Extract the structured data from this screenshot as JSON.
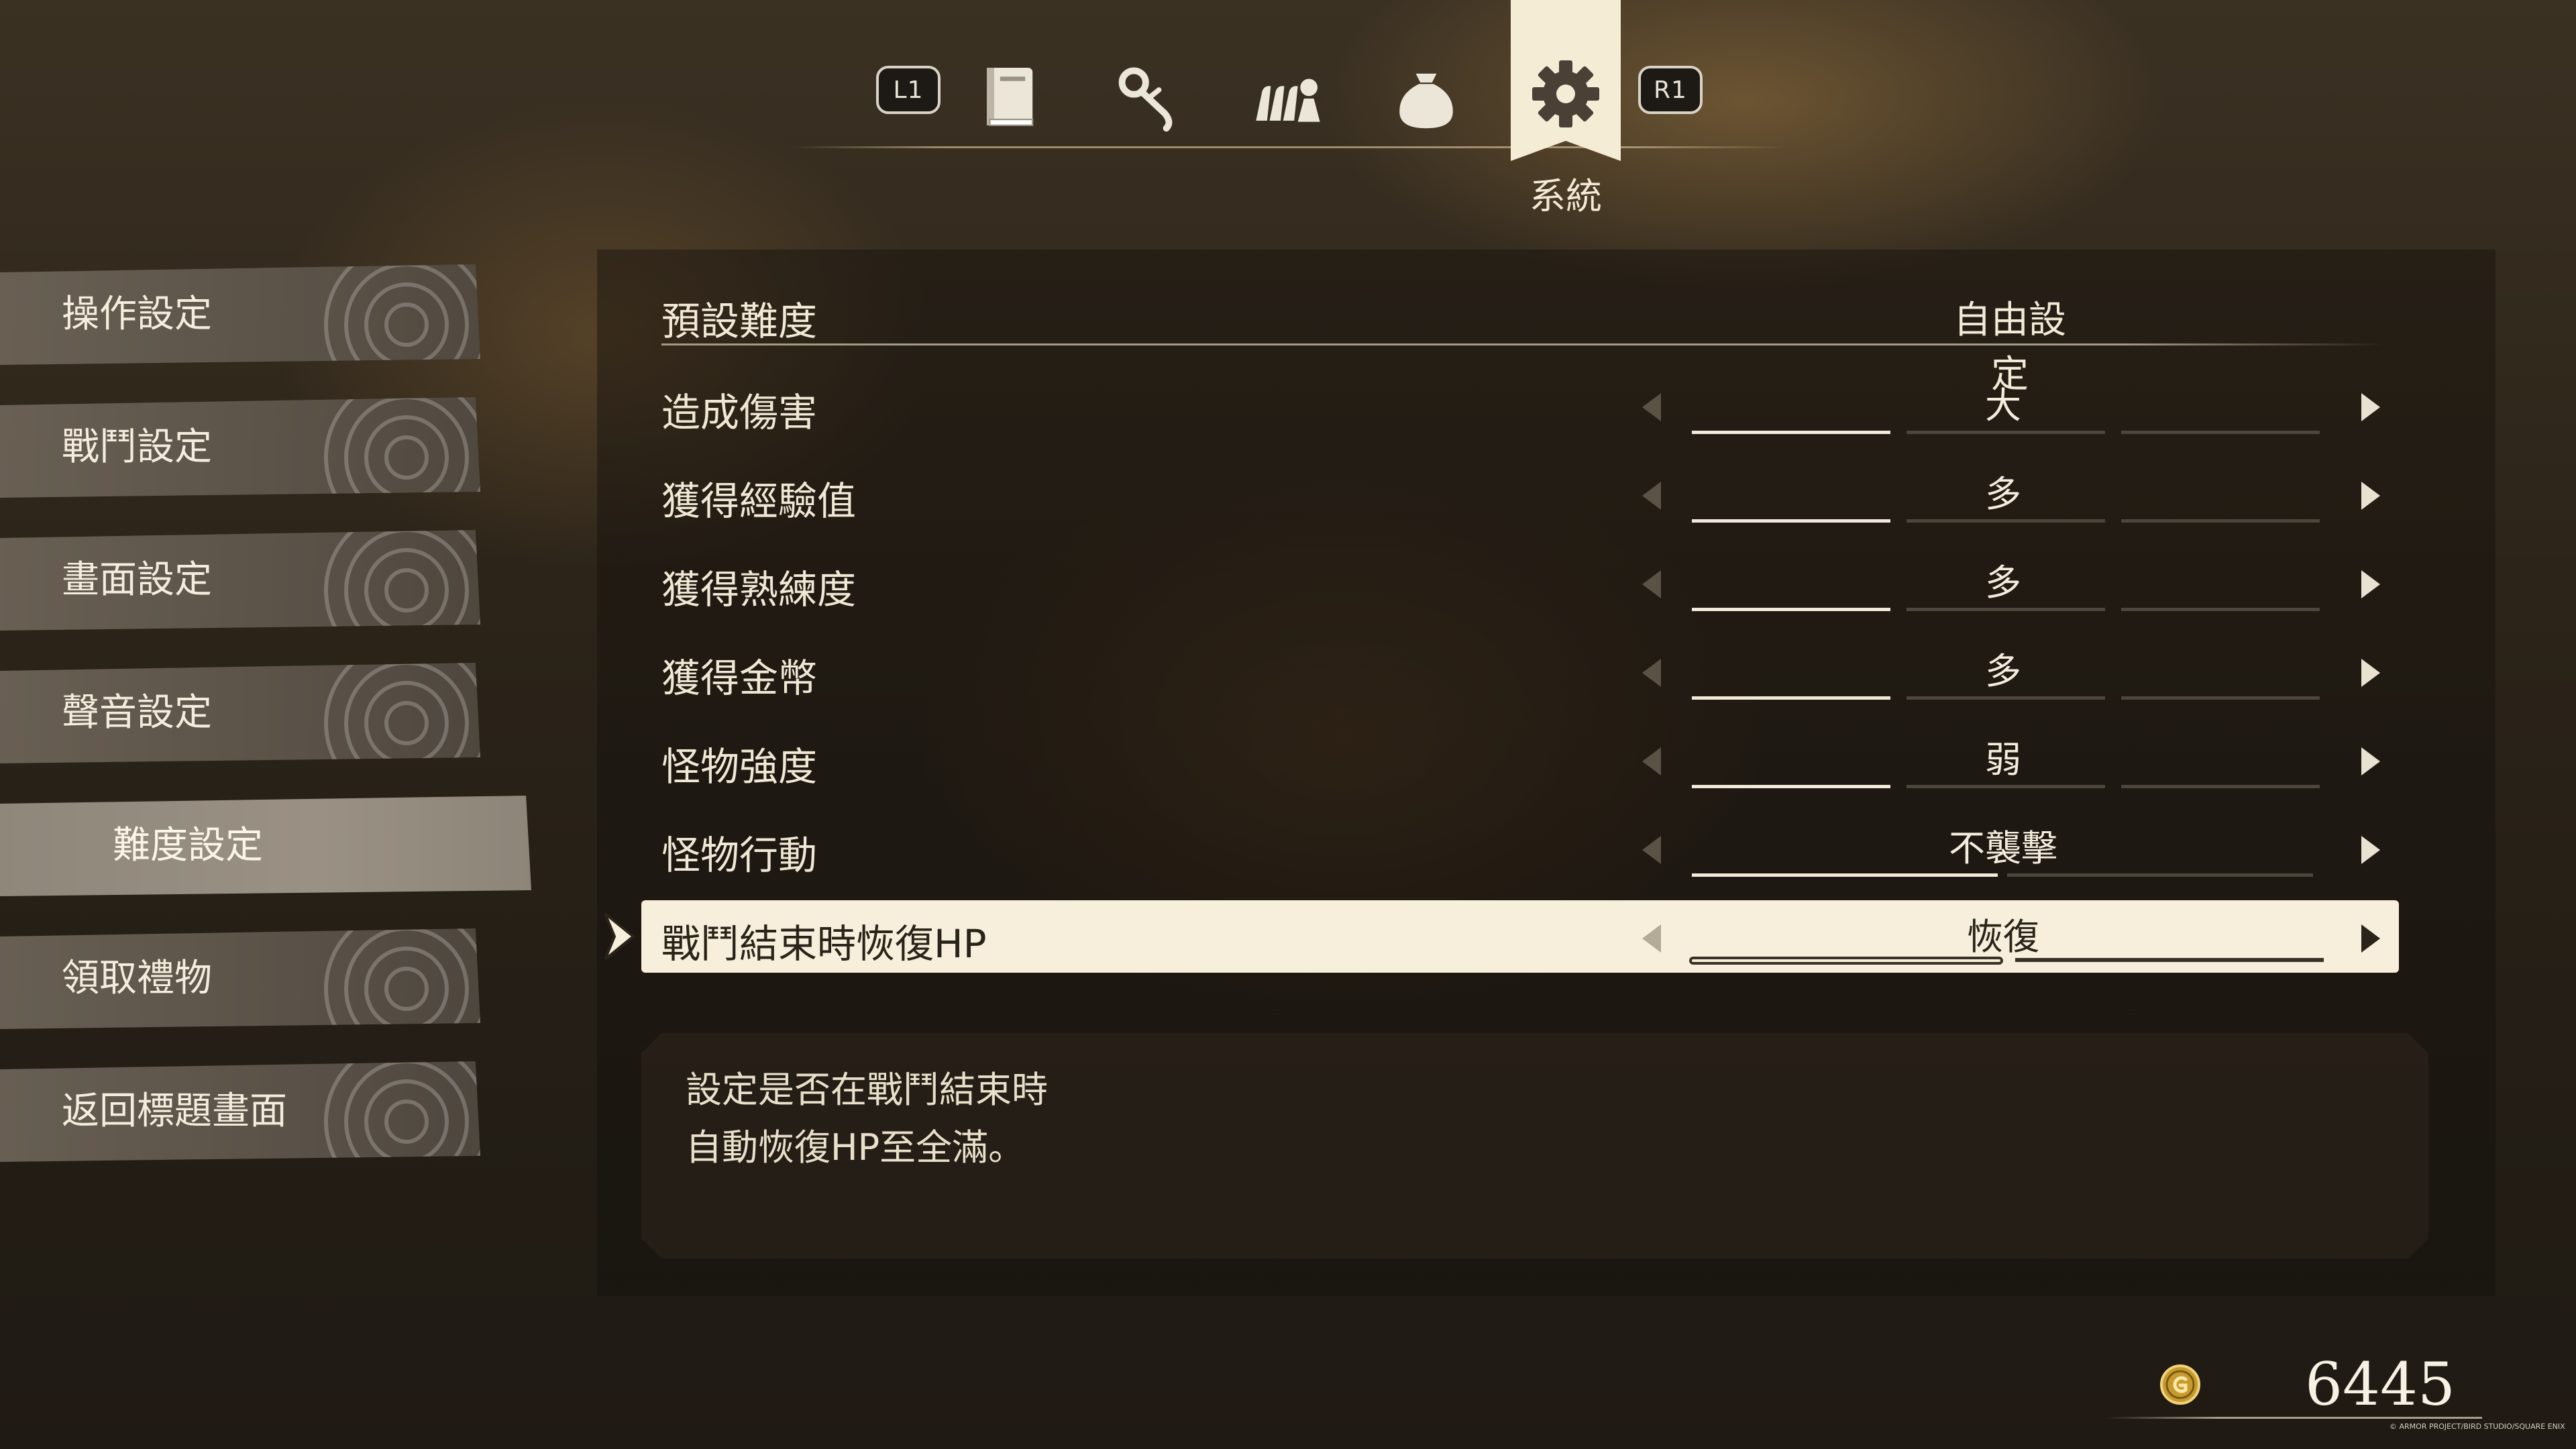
{
  "tabs": {
    "left_shoulder": "L1",
    "right_shoulder": "R1",
    "items": [
      {
        "icon": "book-icon"
      },
      {
        "icon": "staff-icon"
      },
      {
        "icon": "party-icon"
      },
      {
        "icon": "bag-icon"
      },
      {
        "icon": "gear-icon",
        "label": "系統"
      }
    ]
  },
  "sidebar": {
    "items": [
      {
        "label": "操作設定"
      },
      {
        "label": "戰鬥設定"
      },
      {
        "label": "畫面設定"
      },
      {
        "label": "聲音設定"
      },
      {
        "label": "難度設定",
        "selected": true
      },
      {
        "label": "領取禮物"
      },
      {
        "label": "返回標題畫面"
      }
    ]
  },
  "settings": {
    "header": {
      "label": "預設難度",
      "value": "自由設定"
    },
    "rows": [
      {
        "label": "造成傷害",
        "value": "大",
        "level": 1,
        "of": 3
      },
      {
        "label": "獲得經驗值",
        "value": "多",
        "level": 1,
        "of": 3
      },
      {
        "label": "獲得熟練度",
        "value": "多",
        "level": 1,
        "of": 3
      },
      {
        "label": "獲得金幣",
        "value": "多",
        "level": 1,
        "of": 3
      },
      {
        "label": "怪物強度",
        "value": "弱",
        "level": 1,
        "of": 3
      },
      {
        "label": "怪物行動",
        "value": "不襲擊",
        "level": 1,
        "of": 2
      },
      {
        "label": "戰鬥結束時恢復HP",
        "value": "恢復",
        "level": 1,
        "of": 2,
        "selected": true
      }
    ]
  },
  "description": {
    "line1": "設定是否在戰鬥結束時",
    "line2": "自動恢復HP至全滿。"
  },
  "gold": {
    "value": "6445"
  },
  "copyright": "© ARMOR PROJECT/BIRD STUDIO/SQUARE ENIX",
  "colors": {
    "accent": "#f7efdb",
    "background": "#2c2419",
    "text": "#f0e7d4"
  }
}
